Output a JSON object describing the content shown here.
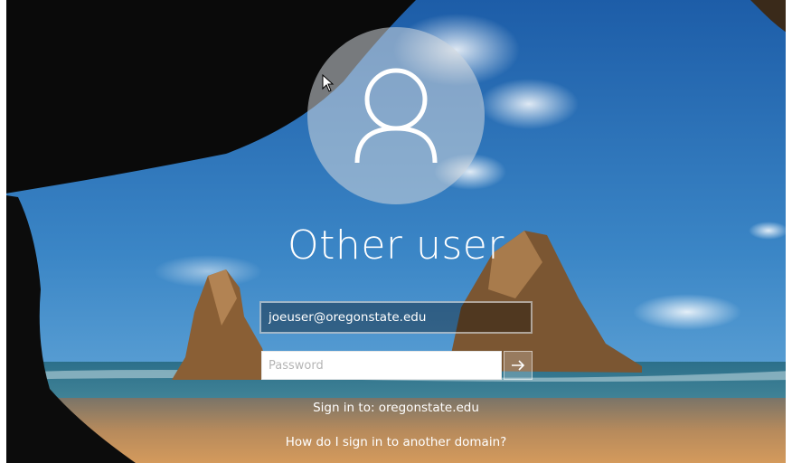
{
  "login": {
    "username": "Other user",
    "user_field_value": "joeuser@oregonstate.edu",
    "password_placeholder": "Password",
    "sign_in_to": "Sign in to: oregonstate.edu",
    "other_domain_link": "How do I sign in to another domain?"
  },
  "icons": {
    "avatar": "user-silhouette-icon",
    "submit": "arrow-right-icon",
    "cursor": "mouse-pointer-icon"
  },
  "colors": {
    "sky": "#2f6fae",
    "cave": "#0b0b0b",
    "sand": "#c08a52",
    "text": "#ffffff"
  }
}
